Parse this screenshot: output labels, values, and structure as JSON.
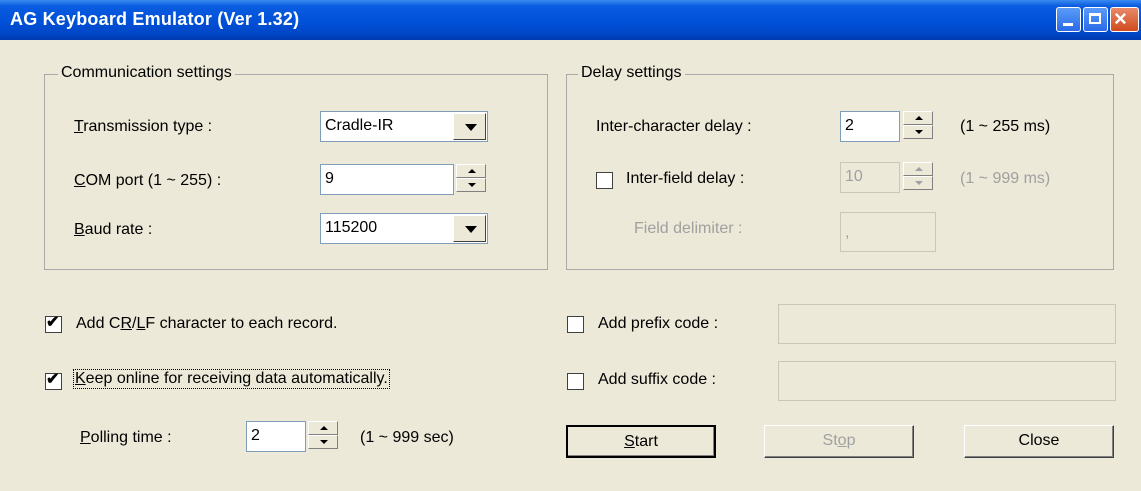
{
  "window": {
    "title": "AG Keyboard Emulator (Ver 1.32)"
  },
  "communication": {
    "legend": "Communication settings",
    "transmission": {
      "label_pre": "",
      "label_ul": "T",
      "label_post": "ransmission type :",
      "value": "Cradle-IR"
    },
    "com_port": {
      "label_ul": "C",
      "label_post": "OM port (1 ~ 255) :",
      "value": "9"
    },
    "baud": {
      "label_ul": "B",
      "label_post": "aud rate :",
      "value": "115200"
    }
  },
  "delay": {
    "legend": "Delay settings",
    "inter_char": {
      "label": "Inter-character delay :",
      "value": "2",
      "range": "(1 ~ 255 ms)"
    },
    "inter_field": {
      "label": "Inter-field delay :",
      "value": "10",
      "range": "(1 ~ 999 ms)",
      "checked": false
    },
    "field_delim": {
      "label": "Field delimiter :",
      "value": ","
    }
  },
  "options": {
    "crlf": {
      "pre": "Add C",
      "ul1": "R",
      "mid": "/",
      "ul2": "L",
      "post": "F character to each record.",
      "checked": true
    },
    "keep_online": {
      "ul": "K",
      "post": "eep online for receiving data automatically.",
      "checked": true
    },
    "polling": {
      "label_ul": "P",
      "label_post": "olling time :",
      "value": "2",
      "range": "(1 ~ 999 sec)"
    },
    "prefix": {
      "label": "Add prefix code :",
      "value": "",
      "checked": false
    },
    "suffix": {
      "label": "Add suffix code :",
      "value": "",
      "checked": false
    }
  },
  "buttons": {
    "start": {
      "ul": "S",
      "post": "tart"
    },
    "stop": {
      "pre": "St",
      "ul": "o",
      "post": "p"
    },
    "close": "Close"
  },
  "check_glyph": "✔",
  "title_controls": {
    "minimize": "minimize-icon",
    "maximize": "maximize-icon",
    "close": "close-icon"
  }
}
